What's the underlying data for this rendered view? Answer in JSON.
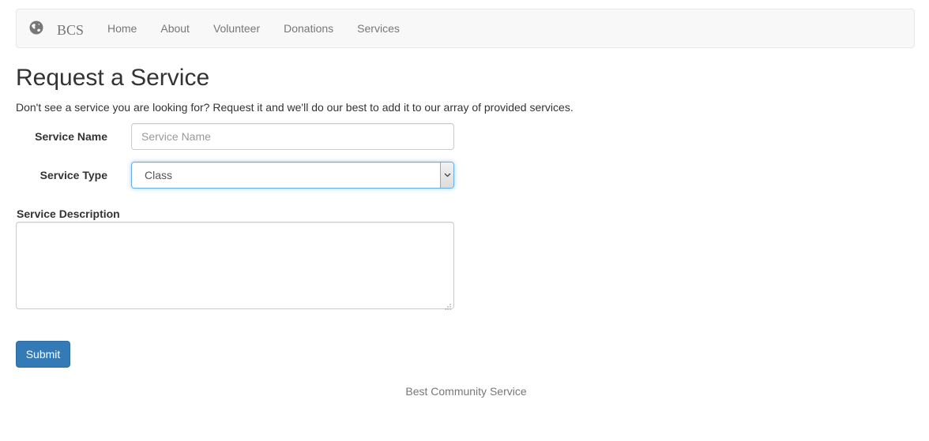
{
  "navbar": {
    "brand_icon": "globe-icon",
    "brand": "BCS",
    "items": [
      {
        "label": "Home"
      },
      {
        "label": "About"
      },
      {
        "label": "Volunteer"
      },
      {
        "label": "Donations"
      },
      {
        "label": "Services"
      }
    ]
  },
  "page": {
    "title": "Request a Service",
    "intro": "Don't see a service you are looking for? Request it and we'll do our best to add it to our array of provided services."
  },
  "form": {
    "service_name": {
      "label": "Service Name",
      "placeholder": "Service Name",
      "value": ""
    },
    "service_type": {
      "label": "Service Type",
      "selected": "Class"
    },
    "service_description": {
      "label": "Service Description",
      "value": ""
    },
    "submit_label": "Submit"
  },
  "footer": {
    "text": "Best Community Service"
  },
  "colors": {
    "primary": "#337ab7",
    "focus": "#66afe9",
    "navbar_bg": "#f8f8f8"
  }
}
